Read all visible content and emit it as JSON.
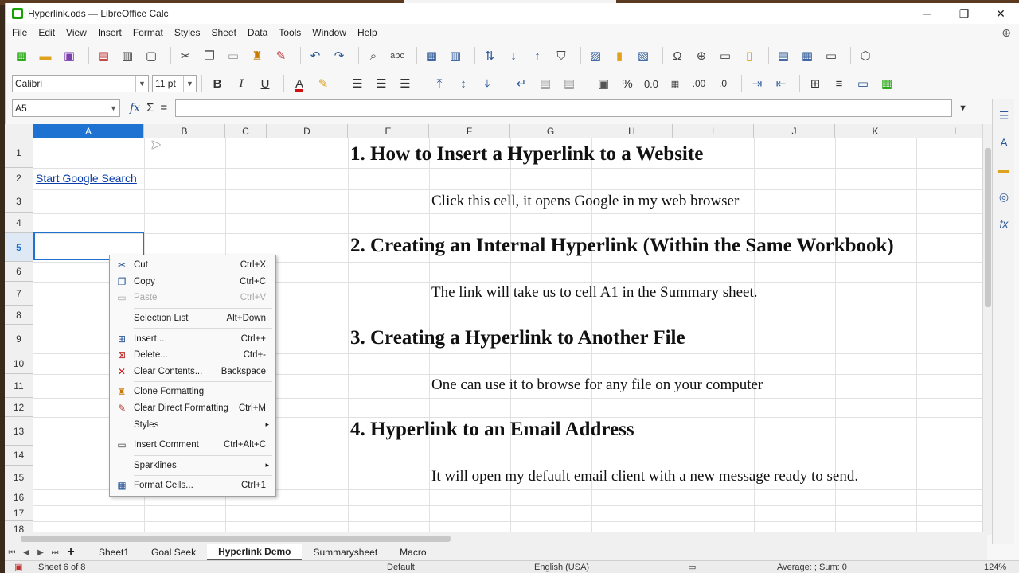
{
  "window": {
    "title": "Hyperlink.ods — LibreOffice Calc",
    "controls": [
      "─",
      "❐",
      "✕"
    ]
  },
  "menu": [
    "File",
    "Edit",
    "View",
    "Insert",
    "Format",
    "Styles",
    "Sheet",
    "Data",
    "Tools",
    "Window",
    "Help"
  ],
  "format_bar": {
    "font_name": "Calibri",
    "font_size": "11 pt",
    "bold": "B",
    "italic": "I",
    "underline": "U"
  },
  "formula_bar": {
    "name_box": "A5",
    "fx": "fx",
    "sigma": "Σ",
    "equals": "="
  },
  "columns": [
    "A",
    "B",
    "C",
    "D",
    "E",
    "F",
    "G",
    "H",
    "I",
    "J",
    "K",
    "L"
  ],
  "rows": [
    "1",
    "2",
    "3",
    "4",
    "5",
    "6",
    "7",
    "8",
    "9",
    "10",
    "11",
    "12",
    "13",
    "14",
    "15",
    "16",
    "17",
    "18"
  ],
  "cells": {
    "a2_link": "Start Google Search"
  },
  "content": {
    "h1": "1.   How to Insert a Hyperlink to a Website",
    "t1": "Click this cell, it opens Google in my web browser",
    "h2": "2.  Creating an Internal Hyperlink (Within the Same Workbook)",
    "t2": "The link will take us to cell A1 in the Summary sheet.",
    "h3": "3. Creating a Hyperlink to Another File",
    "t3": "One can  use it to browse for any file on your computer",
    "h4": "4. Hyperlink to an Email Address",
    "t4": "It will open my default email client with a new message ready to send."
  },
  "context_menu": [
    {
      "label": "Cut",
      "shortcut": "Ctrl+X",
      "icon": "scissors-icon"
    },
    {
      "label": "Copy",
      "shortcut": "Ctrl+C",
      "icon": "copy-icon"
    },
    {
      "label": "Paste",
      "shortcut": "Ctrl+V",
      "icon": "paste-icon",
      "disabled": true
    },
    {
      "label": "Selection List",
      "shortcut": "Alt+Down",
      "icon": ""
    },
    {
      "label": "Insert...",
      "shortcut": "Ctrl++",
      "icon": "insert-cells-icon"
    },
    {
      "label": "Delete...",
      "shortcut": "Ctrl+-",
      "icon": "delete-cells-icon"
    },
    {
      "label": "Clear Contents...",
      "shortcut": "Backspace",
      "icon": "clear-icon"
    },
    {
      "label": "Clone Formatting",
      "shortcut": "",
      "icon": "paintbrush-icon"
    },
    {
      "label": "Clear Direct Formatting",
      "shortcut": "Ctrl+M",
      "icon": "clear-formatting-icon"
    },
    {
      "label": "Styles",
      "shortcut": "",
      "icon": ""
    },
    {
      "label": "Insert Comment",
      "shortcut": "Ctrl+Alt+C",
      "icon": "comment-icon"
    },
    {
      "label": "Sparklines",
      "shortcut": "",
      "icon": ""
    },
    {
      "label": "Format Cells...",
      "shortcut": "Ctrl+1",
      "icon": "format-cells-icon"
    }
  ],
  "sheet_tabs": [
    "Sheet1",
    "Goal Seek",
    "Hyperlink Demo",
    "Summarysheet",
    "Macro"
  ],
  "active_tab": "Hyperlink Demo",
  "status": {
    "sheet": "Sheet 6 of 8",
    "style": "Default",
    "language": "English (USA)",
    "summary": "Average: ; Sum: 0",
    "zoom": "124%"
  },
  "colors": {
    "accent": "#1e73d2",
    "link": "#0b3ea8"
  }
}
